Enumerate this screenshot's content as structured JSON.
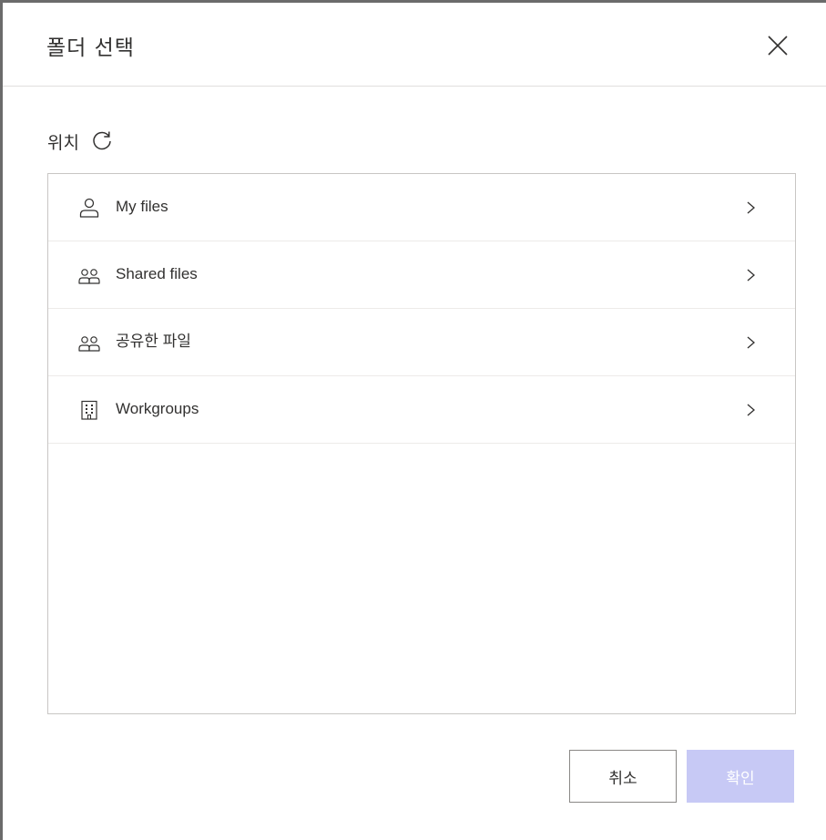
{
  "dialog": {
    "title": "폴더 선택",
    "close_icon": "close-icon"
  },
  "location": {
    "label": "위치",
    "refresh_icon": "refresh-icon"
  },
  "list": {
    "items": [
      {
        "label": "My files",
        "icon": "person-icon"
      },
      {
        "label": "Shared files",
        "icon": "people-icon"
      },
      {
        "label": "공유한 파일",
        "icon": "people-icon"
      },
      {
        "label": "Workgroups",
        "icon": "building-icon"
      }
    ],
    "chevron_icon": "chevron-right-icon"
  },
  "footer": {
    "cancel_label": "취소",
    "ok_label": "확인",
    "ok_color": "#c7c9f5"
  }
}
